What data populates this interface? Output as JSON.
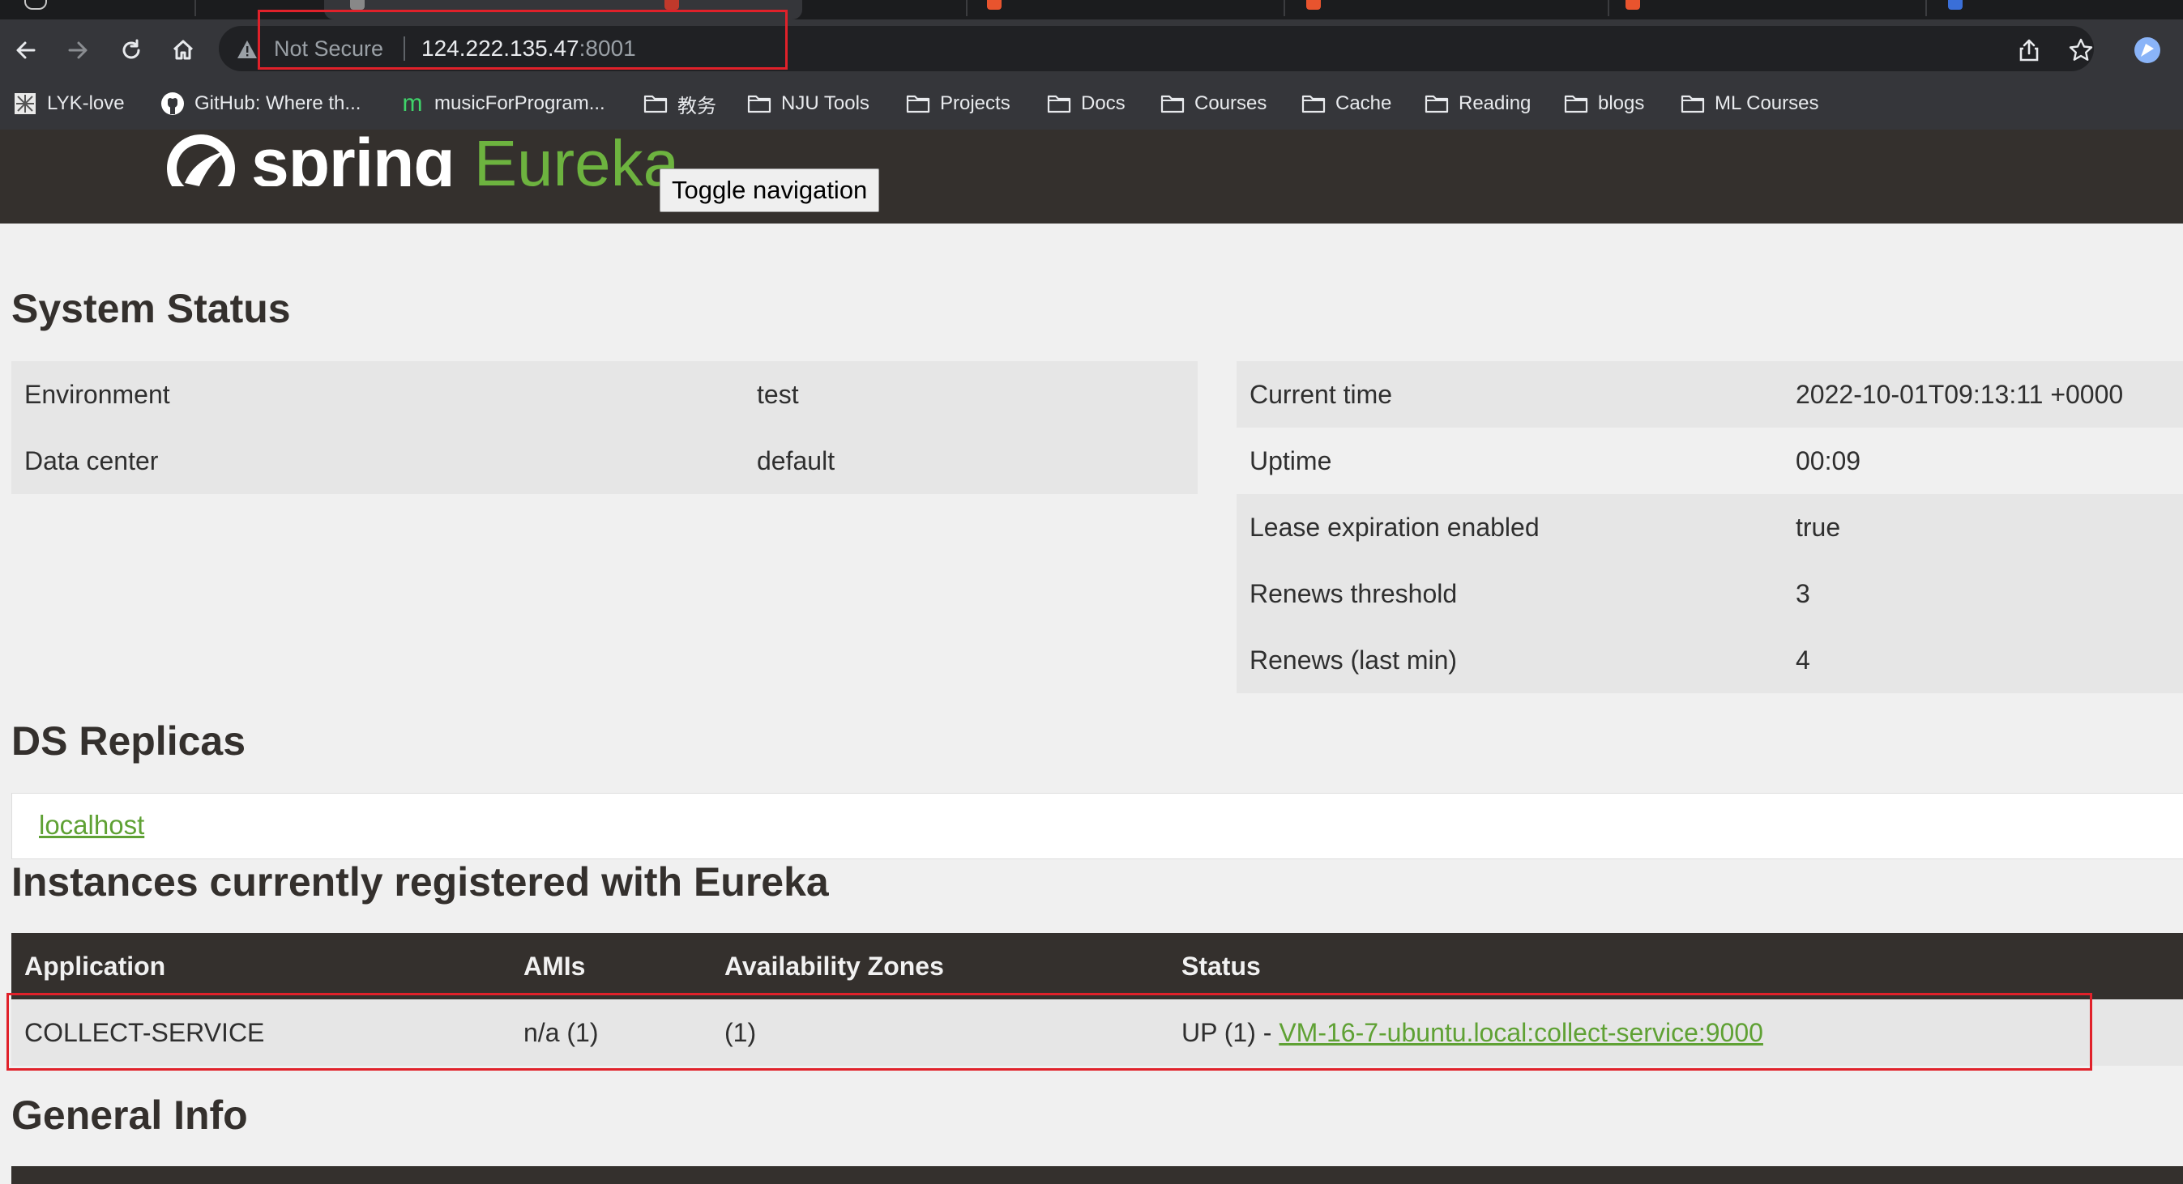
{
  "browser": {
    "security_label": "Not Secure",
    "url_host": "124.222.135.47",
    "url_port": ":8001",
    "nav_icons": [
      "back-icon",
      "forward-icon",
      "reload-icon",
      "home-icon"
    ],
    "toolbar_icons": [
      "share-icon",
      "bookmark-star-icon",
      "profile-icon"
    ],
    "bookmarks": [
      {
        "label": "LYK-love",
        "icon": "site-icon"
      },
      {
        "label": "GitHub: Where th...",
        "icon": "github-icon"
      },
      {
        "label": "musicForProgram...",
        "icon": "m-icon"
      },
      {
        "label": "教务",
        "icon": "folder-icon"
      },
      {
        "label": "NJU Tools",
        "icon": "folder-icon"
      },
      {
        "label": "Projects",
        "icon": "folder-icon"
      },
      {
        "label": "Docs",
        "icon": "folder-icon"
      },
      {
        "label": "Courses",
        "icon": "folder-icon"
      },
      {
        "label": "Cache",
        "icon": "folder-icon"
      },
      {
        "label": "Reading",
        "icon": "folder-icon"
      },
      {
        "label": "blogs",
        "icon": "folder-icon"
      },
      {
        "label": "ML Courses",
        "icon": "folder-icon"
      }
    ]
  },
  "navbar": {
    "logo_spring": "spring",
    "logo_eureka": "Eureka",
    "toggle_label": "Toggle navigation"
  },
  "system_status": {
    "heading": "System Status",
    "left": [
      {
        "key": "Environment",
        "value": "test"
      },
      {
        "key": "Data center",
        "value": "default"
      }
    ],
    "right": [
      {
        "key": "Current time",
        "value": "2022-10-01T09:13:11 +0000"
      },
      {
        "key": "Uptime",
        "value": "00:09"
      },
      {
        "key": "Lease expiration enabled",
        "value": "true"
      },
      {
        "key": "Renews threshold",
        "value": "3"
      },
      {
        "key": "Renews (last min)",
        "value": "4"
      }
    ]
  },
  "ds_replicas": {
    "heading": "DS Replicas",
    "link": "localhost"
  },
  "instances": {
    "heading": "Instances currently registered with Eureka",
    "columns": [
      "Application",
      "AMIs",
      "Availability Zones",
      "Status"
    ],
    "rows": [
      {
        "application": "COLLECT-SERVICE",
        "amis": "n/a (1)",
        "zones": "(1)",
        "status_prefix": "UP (1) - ",
        "status_link": "VM-16-7-ubuntu.local:collect-service:9000"
      }
    ]
  },
  "general_info": {
    "heading": "General Info"
  },
  "colors": {
    "accent_green": "#6db33f",
    "link_green": "#5fa134",
    "dark_header": "#34302d",
    "highlight_red": "#e0212a"
  }
}
